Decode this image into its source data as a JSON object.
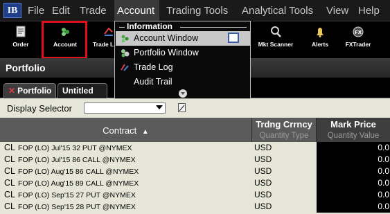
{
  "menubar": {
    "logo": "IB",
    "items": [
      "File",
      "Edit",
      "Trade",
      "Account",
      "Trading Tools",
      "Analytical Tools",
      "View",
      "Help"
    ]
  },
  "toolbar": {
    "buttons": [
      {
        "label": "Order",
        "icon": "order-icon"
      },
      {
        "label": "Account",
        "icon": "account-icon"
      },
      {
        "label": "Trade L",
        "icon": "trade-log-icon"
      },
      {
        "label": "Mkt Scanner",
        "icon": "magnifier-icon"
      },
      {
        "label": "Alerts",
        "icon": "bell-icon"
      },
      {
        "label": "FXTrader",
        "icon": "fx-icon"
      }
    ]
  },
  "portfolio": {
    "title": "Portfolio",
    "tabs": [
      "Portfolio",
      "Untitled"
    ],
    "display_selector_label": "Display Selector",
    "display_selector_value": ""
  },
  "columns": {
    "contract": "Contract",
    "currency_title": "Trdng Crrncy",
    "currency_sub": "Quantity Type",
    "mark_title": "Mark Price",
    "mark_sub": "Quantity Value"
  },
  "rows": [
    {
      "symbol": "CL",
      "desc": "FOP (LO) Jul'15 32 PUT @NYMEX",
      "currency": "USD",
      "mark": "0.0"
    },
    {
      "symbol": "CL",
      "desc": "FOP (LO) Jul'15 86 CALL @NYMEX",
      "currency": "USD",
      "mark": "0.0"
    },
    {
      "symbol": "CL",
      "desc": "FOP (LO) Aug'15 86 CALL @NYMEX",
      "currency": "USD",
      "mark": "0.0"
    },
    {
      "symbol": "CL",
      "desc": "FOP (LO) Aug'15 89 CALL @NYMEX",
      "currency": "USD",
      "mark": "0.0"
    },
    {
      "symbol": "CL",
      "desc": "FOP (LO) Sep'15 27 PUT @NYMEX",
      "currency": "USD",
      "mark": "0.0"
    },
    {
      "symbol": "CL",
      "desc": "FOP (LO) Sep'15 28 PUT @NYMEX",
      "currency": "USD",
      "mark": "0.0"
    }
  ],
  "dropdown": {
    "header": "Information",
    "items": [
      "Account Window",
      "Portfolio Window",
      "Trade Log",
      "Audit Trail"
    ]
  },
  "colors": {
    "highlight": "#e0101b",
    "row_bg": "#e6e6d8",
    "menu_bg": "#1a1a1a"
  }
}
